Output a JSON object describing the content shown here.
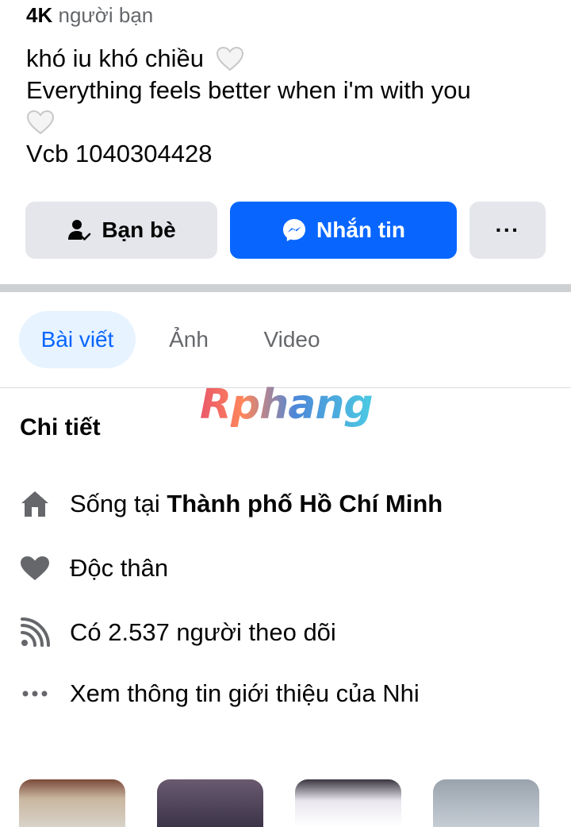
{
  "profile": {
    "friends_count": "4K",
    "friends_label": "người bạn",
    "bio_line1": "khó iu khó chiều",
    "bio_line2": "Everything feels better when i'm with you",
    "bio_line4": "Vcb 1040304428"
  },
  "actions": {
    "friends_label": "Bạn bè",
    "message_label": "Nhắn tin",
    "more_label": "···"
  },
  "tabs": [
    {
      "label": "Bài viết",
      "active": true
    },
    {
      "label": "Ảnh",
      "active": false
    },
    {
      "label": "Video",
      "active": false
    }
  ],
  "watermark": "Rphang",
  "details": {
    "title": "Chi tiết",
    "lives_prefix": "Sống tại ",
    "lives_city": "Thành phố Hồ Chí Minh",
    "relationship": "Độc thân",
    "followers": "Có 2.537 người theo dõi",
    "about": "Xem thông tin giới thiệu của Nhi"
  },
  "icons": {
    "heart_emoji": "white-heart-icon",
    "friends": "friend-check-icon",
    "messenger": "messenger-icon",
    "more": "more-dots-icon",
    "home": "home-icon",
    "relationship": "heart-icon",
    "followers": "rss-icon",
    "about": "ellipsis-icon"
  },
  "colors": {
    "primary": "#0866ff",
    "button_gray": "#e4e6eb",
    "tab_active_bg": "#e7f3ff",
    "secondary_text": "#65676b"
  }
}
